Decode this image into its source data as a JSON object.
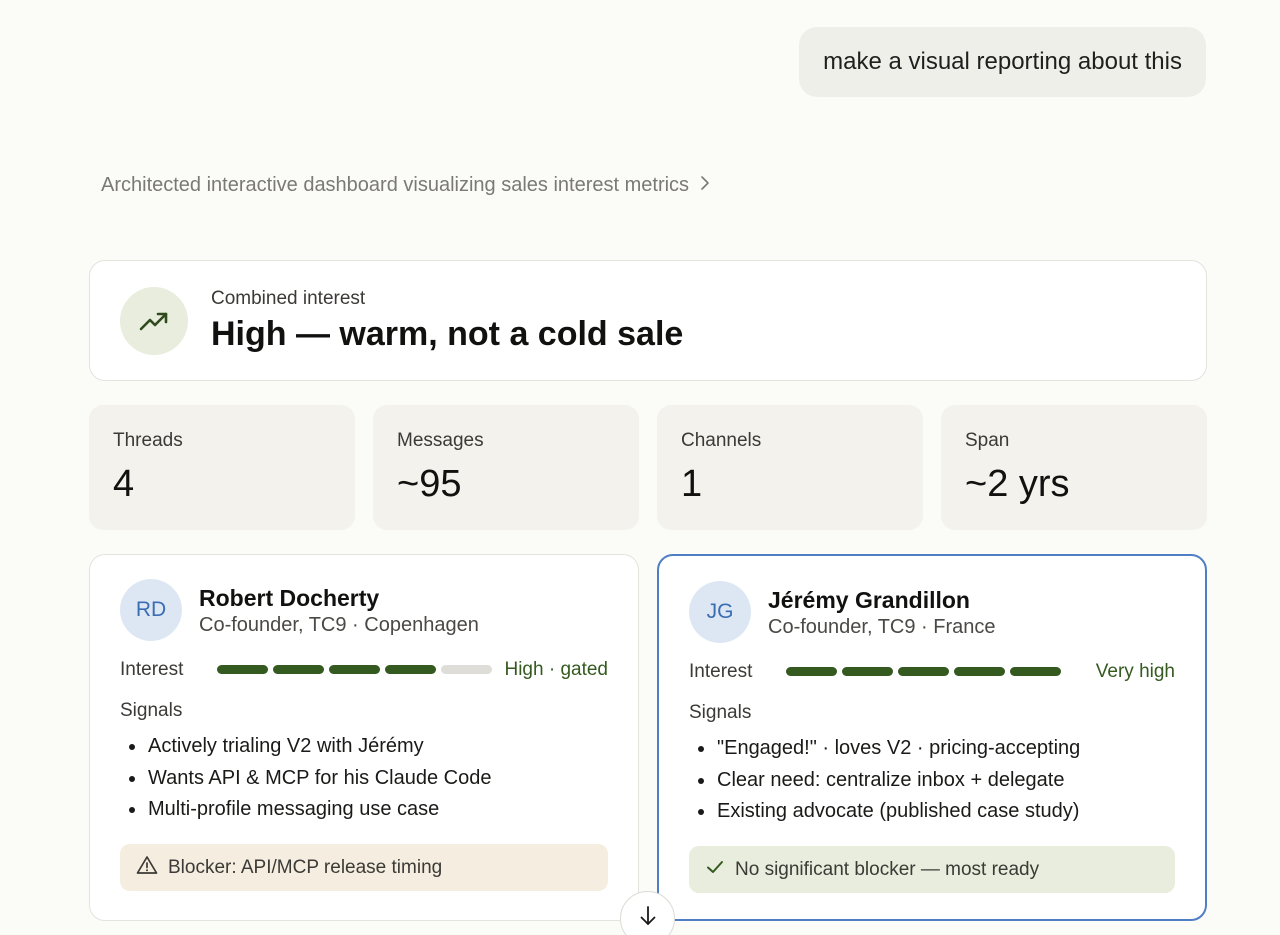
{
  "user_message": "make a visual reporting about this",
  "thinking_summary": "Architected interactive dashboard visualizing sales interest metrics",
  "combined": {
    "label": "Combined interest",
    "value": "High — warm, not a cold sale",
    "icon": "trending-up-icon"
  },
  "stats": [
    {
      "label": "Threads",
      "value": "4"
    },
    {
      "label": "Messages",
      "value": "~95"
    },
    {
      "label": "Channels",
      "value": "1"
    },
    {
      "label": "Span",
      "value": "~2 yrs"
    }
  ],
  "people": [
    {
      "initials": "RD",
      "name": "Robert Docherty",
      "role": "Co-founder, TC9 · Copenhagen",
      "interest_label": "Interest",
      "interest_level": 4,
      "interest_max": 5,
      "interest_text": "High · gated",
      "signals_label": "Signals",
      "signals": [
        "Actively trialing V2 with Jérémy",
        "Wants API & MCP for his Claude Code",
        "Multi-profile messaging use case"
      ],
      "note": "Blocker: API/MCP release timing",
      "note_icon": "warning-icon"
    },
    {
      "initials": "JG",
      "name": "Jérémy Grandillon",
      "role": "Co-founder, TC9 · France",
      "interest_label": "Interest",
      "interest_level": 5,
      "interest_max": 5,
      "interest_text": "Very high",
      "signals_label": "Signals",
      "signals": [
        "\"Engaged!\" · loves V2 · pricing-accepting",
        "Clear need: centralize inbox + delegate",
        "Existing advocate (published case study)"
      ],
      "note": "No significant blocker — most ready",
      "note_icon": "check-icon"
    }
  ],
  "colors": {
    "accent_green": "#355a20",
    "highlight_border": "#4f7ec4",
    "warn_bg": "#f5ede0",
    "ok_bg": "#e8eddd"
  },
  "scroll_icon": "arrow-down-icon"
}
